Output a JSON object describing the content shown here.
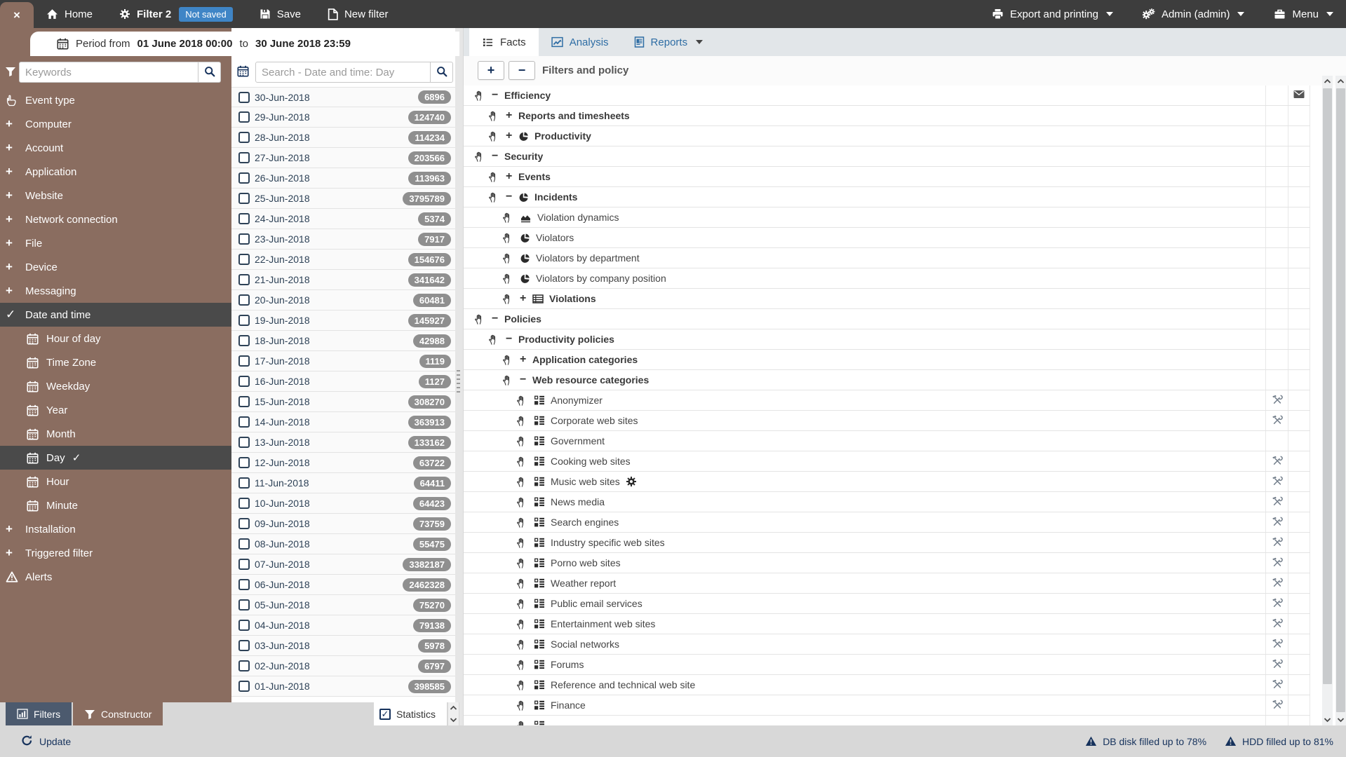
{
  "topbar": {
    "close_label": "×",
    "left_items": [
      {
        "icon": "home-icon",
        "label": "Home"
      },
      {
        "icon": "gear-icon",
        "label": "Filter 2",
        "bold": true,
        "badge": "Not saved"
      },
      {
        "icon": "save-icon",
        "label": "Save"
      },
      {
        "icon": "new-file-icon",
        "label": "New filter"
      }
    ],
    "right_items": [
      {
        "icon": "printer-icon",
        "label": "Export and printing",
        "caret": true
      },
      {
        "icon": "gears-icon",
        "label": "Admin (admin)",
        "caret": true
      },
      {
        "icon": "briefcase-icon",
        "label": "Menu",
        "caret": true
      }
    ]
  },
  "period_bar": {
    "prefix": "Period from",
    "start": "01 June 2018 00:00",
    "middle": "to",
    "end": "30 June 2018 23:59"
  },
  "sidebar": {
    "keywords_placeholder": "Keywords",
    "items": [
      {
        "label": "Event type",
        "icon": "hand-pointer-icon"
      },
      {
        "label": "Computer",
        "expander": "+"
      },
      {
        "label": "Account",
        "expander": "+"
      },
      {
        "label": "Application",
        "expander": "+"
      },
      {
        "label": "Website",
        "expander": "+"
      },
      {
        "label": "Network connection",
        "expander": "+"
      },
      {
        "label": "File",
        "expander": "+"
      },
      {
        "label": "Device",
        "expander": "+"
      },
      {
        "label": "Messaging",
        "expander": "+"
      },
      {
        "label": "Date and time",
        "icon": "check-icon",
        "selected": true
      },
      {
        "label": "Hour of day",
        "icon": "calendar-icon",
        "indent": 1
      },
      {
        "label": "Time Zone",
        "icon": "calendar-icon",
        "indent": 1
      },
      {
        "label": "Weekday",
        "icon": "calendar-icon",
        "indent": 1
      },
      {
        "label": "Year",
        "icon": "calendar-icon",
        "indent": 1
      },
      {
        "label": "Month",
        "icon": "calendar-icon",
        "indent": 1
      },
      {
        "label": "Day",
        "icon": "calendar-icon",
        "indent": 1,
        "selected": true,
        "checked": true
      },
      {
        "label": "Hour",
        "icon": "calendar-icon",
        "indent": 1
      },
      {
        "label": "Minute",
        "icon": "calendar-icon",
        "indent": 1
      },
      {
        "label": "Installation",
        "expander": "+"
      },
      {
        "label": "Triggered filter",
        "expander": "+"
      },
      {
        "label": "Alerts",
        "icon": "alert-icon"
      }
    ]
  },
  "date_panel": {
    "search_placeholder": "Search - Date and time: Day",
    "rows": [
      {
        "date": "30-Jun-2018",
        "count": "6896"
      },
      {
        "date": "29-Jun-2018",
        "count": "124740"
      },
      {
        "date": "28-Jun-2018",
        "count": "114234"
      },
      {
        "date": "27-Jun-2018",
        "count": "203566"
      },
      {
        "date": "26-Jun-2018",
        "count": "113963"
      },
      {
        "date": "25-Jun-2018",
        "count": "3795789"
      },
      {
        "date": "24-Jun-2018",
        "count": "5374"
      },
      {
        "date": "23-Jun-2018",
        "count": "7917"
      },
      {
        "date": "22-Jun-2018",
        "count": "154676"
      },
      {
        "date": "21-Jun-2018",
        "count": "341642"
      },
      {
        "date": "20-Jun-2018",
        "count": "60481"
      },
      {
        "date": "19-Jun-2018",
        "count": "145927"
      },
      {
        "date": "18-Jun-2018",
        "count": "42988"
      },
      {
        "date": "17-Jun-2018",
        "count": "1119"
      },
      {
        "date": "16-Jun-2018",
        "count": "1127"
      },
      {
        "date": "15-Jun-2018",
        "count": "308270"
      },
      {
        "date": "14-Jun-2018",
        "count": "363913"
      },
      {
        "date": "13-Jun-2018",
        "count": "133162"
      },
      {
        "date": "12-Jun-2018",
        "count": "63722"
      },
      {
        "date": "11-Jun-2018",
        "count": "64411"
      },
      {
        "date": "10-Jun-2018",
        "count": "64423"
      },
      {
        "date": "09-Jun-2018",
        "count": "73759"
      },
      {
        "date": "08-Jun-2018",
        "count": "55475"
      },
      {
        "date": "07-Jun-2018",
        "count": "3382187"
      },
      {
        "date": "06-Jun-2018",
        "count": "2462328"
      },
      {
        "date": "05-Jun-2018",
        "count": "75270"
      },
      {
        "date": "04-Jun-2018",
        "count": "79138"
      },
      {
        "date": "03-Jun-2018",
        "count": "5978"
      },
      {
        "date": "02-Jun-2018",
        "count": "6797"
      },
      {
        "date": "01-Jun-2018",
        "count": "398585"
      }
    ],
    "statistics_label": "Statistics",
    "statistics_checked": true,
    "check_glyph": "✓"
  },
  "main": {
    "tabs": [
      {
        "icon": "list-icon",
        "label": "Facts",
        "active": true
      },
      {
        "icon": "line-chart-icon",
        "label": "Analysis"
      },
      {
        "icon": "report-icon",
        "label": "Reports",
        "caret": true
      }
    ],
    "toolbar": {
      "zoom_in": "+",
      "zoom_out": "−",
      "title": "Filters and policy"
    },
    "tree": [
      {
        "label": "Efficiency",
        "indent": 0,
        "expander": "−",
        "bold": true,
        "mail": true
      },
      {
        "label": "Reports and timesheets",
        "indent": 1,
        "expander": "+",
        "bold": true
      },
      {
        "label": "Productivity",
        "indent": 1,
        "expander": "+",
        "icon": "pie-icon",
        "bold": true
      },
      {
        "label": "Security",
        "indent": 0,
        "expander": "−",
        "bold": true
      },
      {
        "label": "Events",
        "indent": 1,
        "expander": "+",
        "bold": true
      },
      {
        "label": "Incidents",
        "indent": 1,
        "expander": "−",
        "icon": "pie-icon",
        "bold": true
      },
      {
        "label": "Violation dynamics",
        "indent": 2,
        "icon": "area-chart-icon"
      },
      {
        "label": "Violators",
        "indent": 2,
        "icon": "pie-icon"
      },
      {
        "label": "Violators by department",
        "indent": 2,
        "icon": "pie-icon"
      },
      {
        "label": "Violators by company position",
        "indent": 2,
        "icon": "pie-icon"
      },
      {
        "label": "Violations",
        "indent": 2,
        "expander": "+",
        "icon": "table-icon",
        "bold": true
      },
      {
        "label": "Policies",
        "indent": 0,
        "expander": "−",
        "bold": true
      },
      {
        "label": "Productivity policies",
        "indent": 1,
        "expander": "−",
        "bold": true
      },
      {
        "label": "Application categories",
        "indent": 2,
        "expander": "+",
        "bold": true
      },
      {
        "label": "Web resource categories",
        "indent": 2,
        "expander": "−",
        "bold": true
      },
      {
        "label": "Anonymizer",
        "indent": 3,
        "icon": "category-icon",
        "tools": true
      },
      {
        "label": "Corporate web sites",
        "indent": 3,
        "icon": "category-icon",
        "tools": true
      },
      {
        "label": "Government",
        "indent": 3,
        "icon": "category-icon",
        "tools": false
      },
      {
        "label": "Cooking web sites",
        "indent": 3,
        "icon": "category-icon",
        "tools": true
      },
      {
        "label": "Music web sites",
        "indent": 3,
        "icon": "category-icon",
        "gear": true,
        "tools": true
      },
      {
        "label": "News media",
        "indent": 3,
        "icon": "category-icon",
        "tools": true
      },
      {
        "label": "Search engines",
        "indent": 3,
        "icon": "category-icon",
        "tools": true
      },
      {
        "label": "Industry specific web sites",
        "indent": 3,
        "icon": "category-icon",
        "tools": true
      },
      {
        "label": "Porno web sites",
        "indent": 3,
        "icon": "category-icon",
        "tools": true
      },
      {
        "label": "Weather report",
        "indent": 3,
        "icon": "category-icon",
        "tools": true
      },
      {
        "label": "Public email services",
        "indent": 3,
        "icon": "category-icon",
        "tools": true
      },
      {
        "label": "Entertainment web sites",
        "indent": 3,
        "icon": "category-icon",
        "tools": true
      },
      {
        "label": "Social networks",
        "indent": 3,
        "icon": "category-icon",
        "tools": true
      },
      {
        "label": "Forums",
        "indent": 3,
        "icon": "category-icon",
        "tools": true
      },
      {
        "label": "Reference and technical web site",
        "indent": 3,
        "icon": "category-icon",
        "tools": true
      },
      {
        "label": "Finance",
        "indent": 3,
        "icon": "category-icon",
        "tools": true
      },
      {
        "label": "",
        "indent": 3,
        "icon": "category-icon",
        "partial": true
      }
    ]
  },
  "bottom_tabs": [
    {
      "icon": "bar-chart-icon",
      "label": "Filters",
      "active": true
    },
    {
      "icon": "funnel-icon",
      "label": "Constructor"
    }
  ],
  "statusbar": {
    "update_label": "Update",
    "warnings": [
      {
        "label": "DB disk filled up to 78%"
      },
      {
        "label": "HDD filled up to 81%"
      }
    ]
  },
  "colors": {
    "topbar_bg": "#3d3d3d",
    "sidebar_brown": "#8a6d60",
    "selected_dark": "#4a4a4a",
    "navy_accent": "#16325c",
    "date_text": "#2e4257",
    "link_blue": "#2e6da4",
    "not_saved_badge": "#3f85c6",
    "count_badge": "#8f8f8f",
    "statusbar_bg": "#d8d8d8",
    "filters_tab_bg": "#4c5a6e"
  }
}
